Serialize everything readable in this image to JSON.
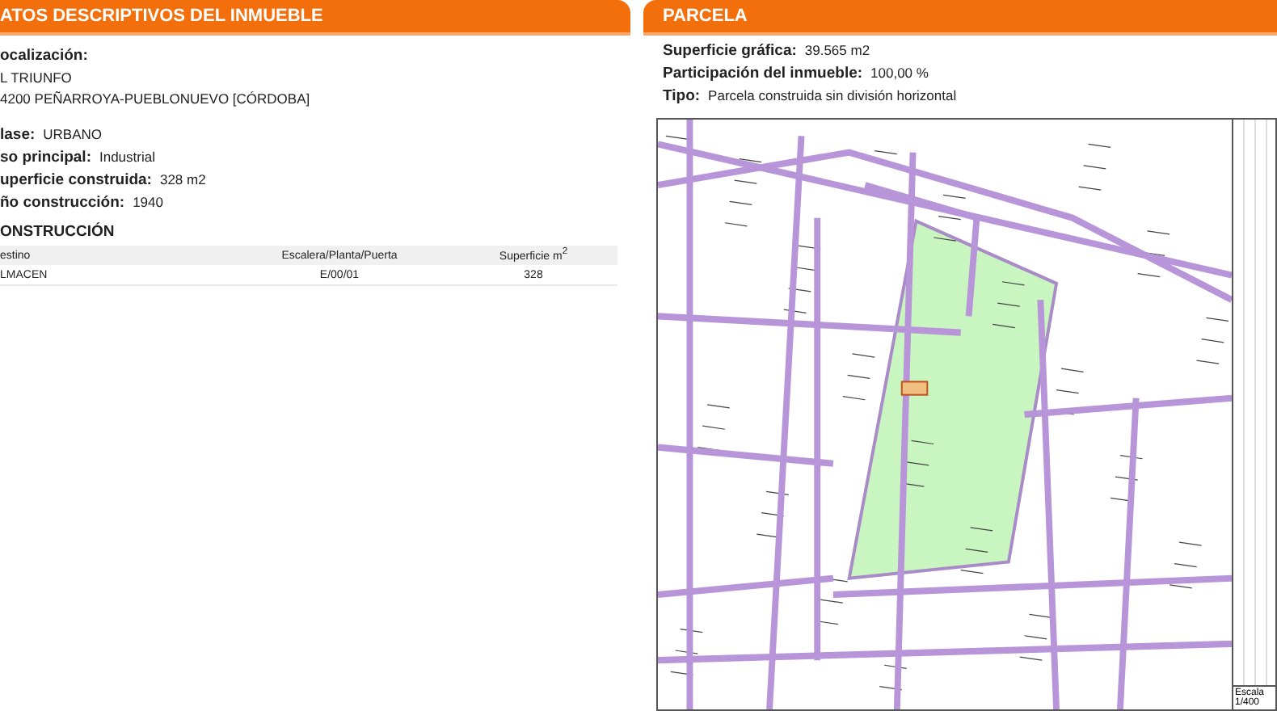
{
  "left_panel": {
    "title": "ATOS DESCRIPTIVOS DEL INMUEBLE",
    "location": {
      "label": "ocalización:",
      "lines": [
        "L TRIUNFO",
        "4200 PEÑARROYA-PUEBLONUEVO [CÓRDOBA]"
      ]
    },
    "fields": [
      {
        "label": "lase:",
        "value": "URBANO"
      },
      {
        "label": "so principal:",
        "value": "Industrial"
      },
      {
        "label": "uperficie construida:",
        "value": "328 m2"
      },
      {
        "label": "ño construcción:",
        "value": "1940"
      }
    ],
    "construction": {
      "title": "ONSTRUCCIÓN",
      "columns": [
        "estino",
        "Escalera/Planta/Puerta",
        "Superficie m$^{2}$"
      ],
      "rows": [
        [
          "LMACEN",
          "E/00/01",
          "328"
        ]
      ]
    }
  },
  "right_panel": {
    "title": "PARCELA",
    "fields": [
      {
        "label": "Superficie gráfica:",
        "value": "39.565 m2"
      },
      {
        "label": "Participación del inmueble:",
        "value": "100,00 %"
      },
      {
        "label": "Tipo:",
        "value": "Parcela construida sin división horizontal"
      }
    ],
    "legend": {
      "scale_label": "Escala",
      "scale_value": "1/400"
    }
  }
}
